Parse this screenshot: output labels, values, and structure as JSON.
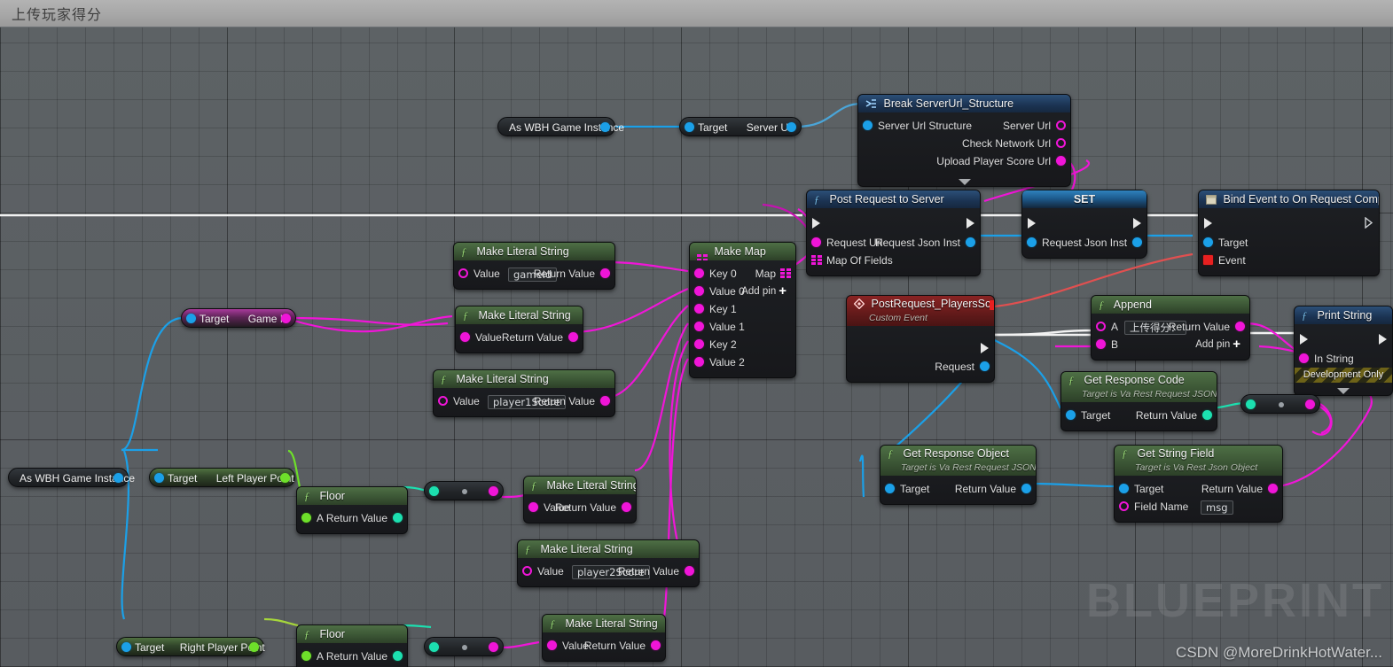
{
  "window": {
    "title": "上传玩家得分"
  },
  "watermark": {
    "big": "BLUEPRINT",
    "credit": "CSDN @MoreDrinkHotWater..."
  },
  "nodes": {
    "as_game_instance_top": {
      "label": "As WBH Game Instance"
    },
    "server_url_getter": {
      "target": "Target",
      "output": "Server Url"
    },
    "break_struct": {
      "title": "Break ServerUrl_Structure",
      "input": "Server Url Structure",
      "out1": "Server Url",
      "out2": "Check Network Url",
      "out3": "Upload Player Score Url"
    },
    "post_request": {
      "title": "Post Request to Server",
      "in_url": "Request Url",
      "in_map": "Map Of Fields",
      "out_json": "Request Json Inst"
    },
    "set_node": {
      "title": "SET",
      "pin": "Request Json Inst"
    },
    "bind_event": {
      "title": "Bind Event to On Request Complete",
      "target": "Target",
      "event": "Event"
    },
    "game_id_getter": {
      "target": "Target",
      "output": "Game Id"
    },
    "literal_gameid": {
      "title": "Make Literal String",
      "value_label": "Value",
      "value": "gameId",
      "ret": "Return Value"
    },
    "literal_empty": {
      "title": "Make Literal String",
      "value_label": "Value",
      "value": "",
      "ret": "Return Value"
    },
    "literal_p1": {
      "title": "Make Literal String",
      "value_label": "Value",
      "value": "player1Score",
      "ret": "Return Value"
    },
    "literal_mid": {
      "title": "Make Literal String",
      "value_label": "Value",
      "value": "",
      "ret": "Return Value"
    },
    "literal_p2": {
      "title": "Make Literal String",
      "value_label": "Value",
      "value": "player2Score",
      "ret": "Return Value"
    },
    "literal_bottom": {
      "title": "Make Literal String",
      "value_label": "Value",
      "value": "",
      "ret": "Return Value"
    },
    "make_map": {
      "title": "Make Map",
      "rows": [
        "Key 0",
        "Value 0",
        "Key 1",
        "Value 1",
        "Key 2",
        "Value 2"
      ],
      "out": "Map",
      "addpin": "Add pin"
    },
    "custom_event": {
      "title": "PostRequest_PlayersScore",
      "subtitle": "Custom Event",
      "out": "Request"
    },
    "append": {
      "title": "Append",
      "a_label": "A",
      "a_value": "上传得分：",
      "b_label": "B",
      "ret": "Return Value",
      "addpin": "Add pin"
    },
    "print_string": {
      "title": "Print String",
      "in_string": "In String",
      "banner": "Development Only"
    },
    "get_response_code": {
      "title": "Get Response Code",
      "subtitle": "Target is Va Rest Request JSON",
      "target": "Target",
      "ret": "Return Value"
    },
    "get_response_object": {
      "title": "Get Response Object",
      "subtitle": "Target is Va Rest Request JSON",
      "target": "Target",
      "ret": "Return Value"
    },
    "get_string_field": {
      "title": "Get String Field",
      "subtitle": "Target is Va Rest Json Object",
      "target": "Target",
      "field_label": "Field Name",
      "field_value": "msg",
      "ret": "Return Value"
    },
    "as_game_instance_bottom": {
      "label": "As WBH Game Instance"
    },
    "left_player_getter": {
      "target": "Target",
      "output": "Left Player Point"
    },
    "right_player_getter": {
      "target": "Target",
      "output": "Right Player Point"
    },
    "floor_left": {
      "title": "Floor",
      "a": "A",
      "ret": "Return Value"
    },
    "floor_right": {
      "title": "Floor",
      "a": "A",
      "ret": "Return Value"
    }
  },
  "colors": {
    "exec_white": "#e8e8e8",
    "string_magenta": "#f015d8",
    "object_blue": "#1ba0e8",
    "float_green": "#6ee02a",
    "int_teal": "#1ce0b0",
    "delegate_red": "#e82020"
  }
}
